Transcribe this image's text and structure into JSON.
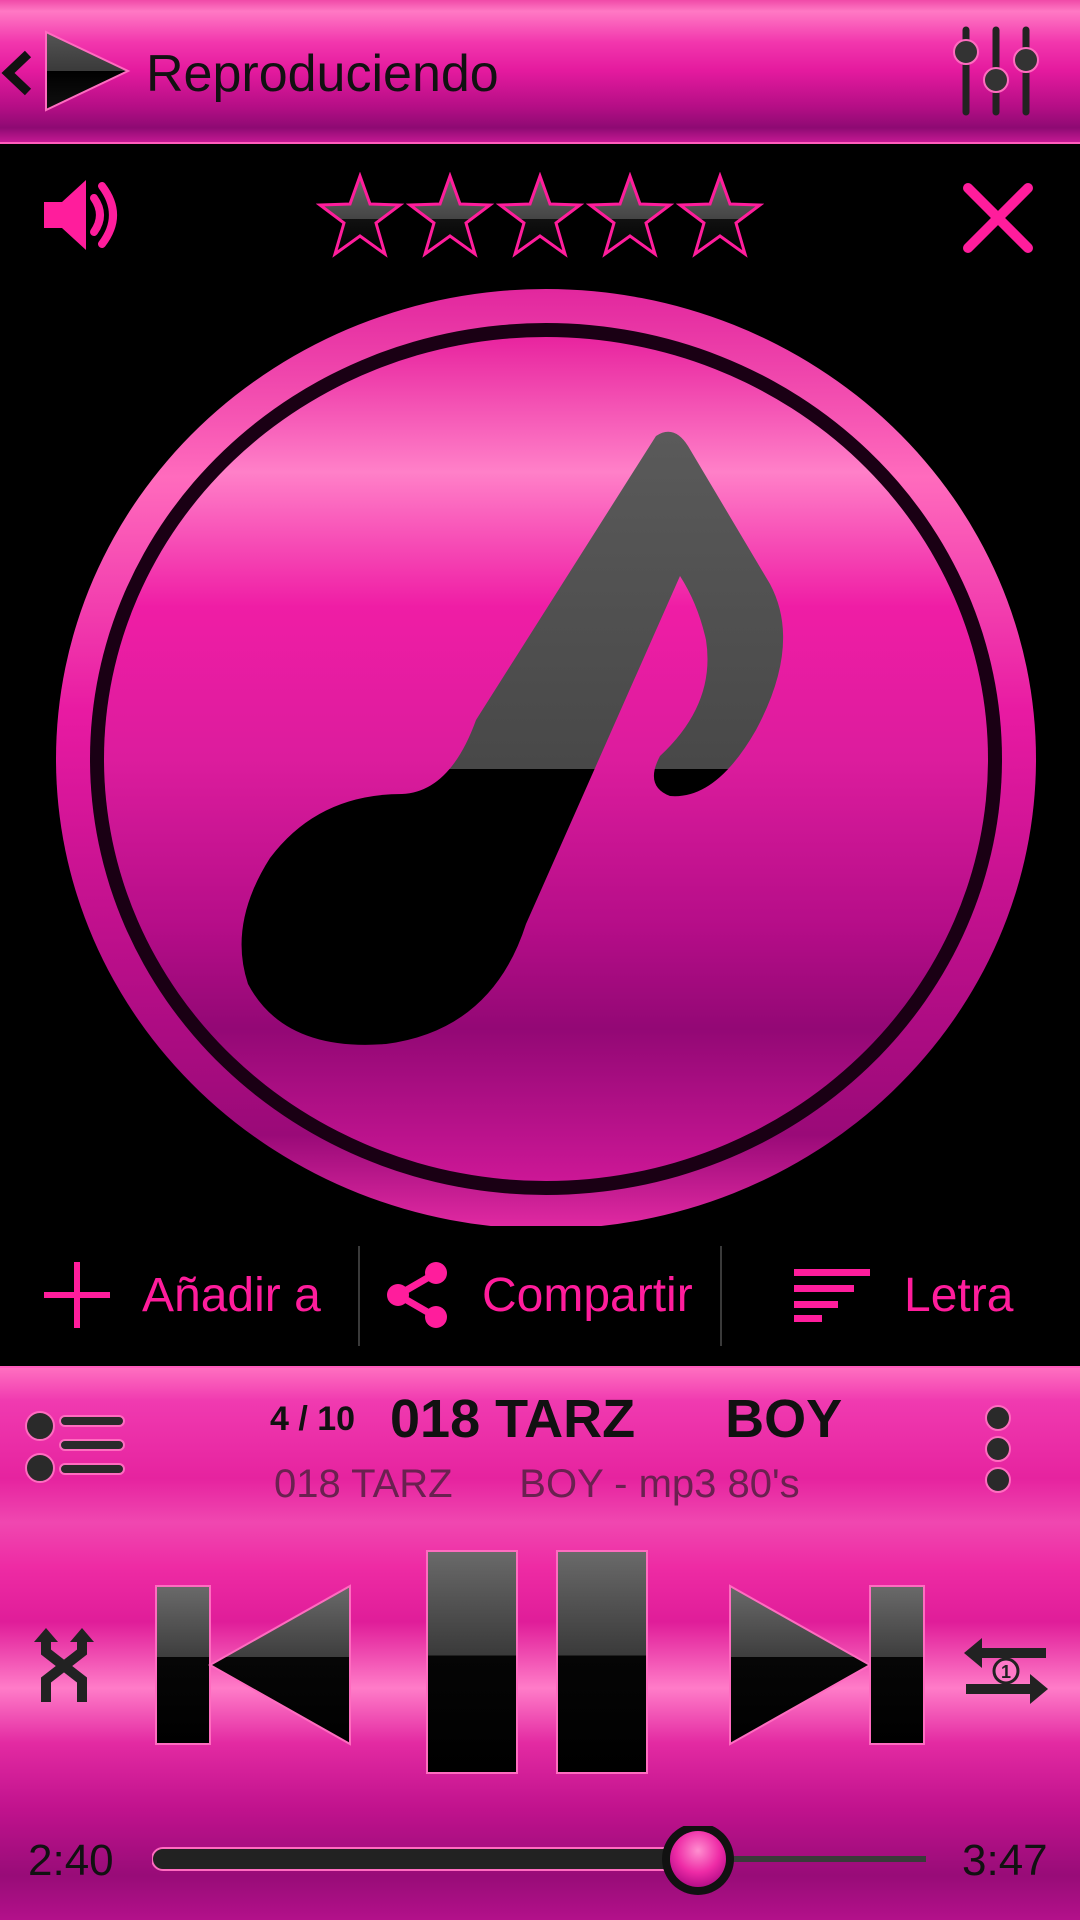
{
  "header": {
    "title": "Reproduciendo",
    "back_icon": "chevron-left-icon",
    "app_icon": "play-icon",
    "equalizer_icon": "equalizer-icon"
  },
  "toolbar": {
    "volume_icon": "speaker-icon",
    "rating": {
      "stars_filled": 0,
      "stars_total": 5
    },
    "close_icon": "close-icon"
  },
  "album_art": {
    "icon": "music-note-icon"
  },
  "actions": [
    {
      "label": "Añadir a",
      "icon": "plus-icon"
    },
    {
      "label": "Compartir",
      "icon": "share-icon"
    },
    {
      "label": "Letra",
      "icon": "lyrics-icon"
    }
  ],
  "now_playing": {
    "counter": "4 / 10",
    "title": "018 TARZ      BOY",
    "subtitle": "018 TARZ      BOY - mp3 80's"
  },
  "controls": {
    "shuffle_icon": "shuffle-icon",
    "prev_icon": "skip-previous-icon",
    "pause_icon": "pause-icon",
    "next_icon": "skip-next-icon",
    "repeat_icon": "repeat-one-icon",
    "playlist_icon": "playlist-icon",
    "overflow_icon": "more-vertical-icon"
  },
  "progress": {
    "elapsed": "2:40",
    "total": "3:47",
    "fraction": 0.7048
  },
  "colors": {
    "accent": "#ff1d9c",
    "background": "#000000",
    "glyph": "#4a4a4a"
  }
}
